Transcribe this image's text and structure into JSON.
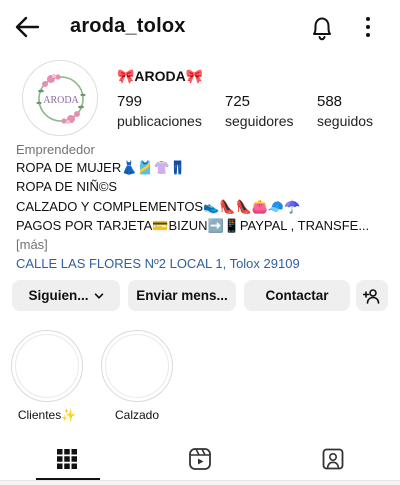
{
  "header": {
    "username": "aroda_tolox",
    "back_icon": "arrow-left-icon",
    "notifications_icon": "bell-icon",
    "menu_icon": "more-vertical-icon"
  },
  "profile": {
    "display_name": "🎀ARODA🎀",
    "avatar_text": "ARODA",
    "stats": {
      "posts": {
        "value": "799",
        "label": "publicaciones"
      },
      "followers": {
        "value": "725",
        "label": "seguidores"
      },
      "following": {
        "value": "588",
        "label": "seguidos"
      }
    },
    "category": "Emprendedor",
    "bio": [
      "ROPA DE MUJER👗🎽👚👖",
      "ROPA DE NIÑ©S",
      "CALZADO Y COMPLEMENTOS👟👠👠👛🧢☂️",
      "PAGOS POR TARJETA💳BIZUN➡️📱PAYPAL , TRANSFE..."
    ],
    "more_label": "[más]",
    "address": "CALLE LAS FLORES Nº2 LOCAL 1, Tolox 29109"
  },
  "actions": {
    "following_label": "Siguien...",
    "message_label": "Enviar mens...",
    "contact_label": "Contactar",
    "add_user_icon": "add-person-icon"
  },
  "highlights": [
    {
      "label": "Clientes✨"
    },
    {
      "label": "Calzado"
    }
  ],
  "tabs": [
    {
      "name": "posts-grid",
      "icon": "grid-icon",
      "active": true
    },
    {
      "name": "reels",
      "icon": "reels-icon",
      "active": false
    },
    {
      "name": "tagged",
      "icon": "tagged-user-icon",
      "active": false
    }
  ],
  "colors": {
    "link": "#2f5f9c",
    "secondary_text": "#737373",
    "button_bg": "#efefef"
  }
}
